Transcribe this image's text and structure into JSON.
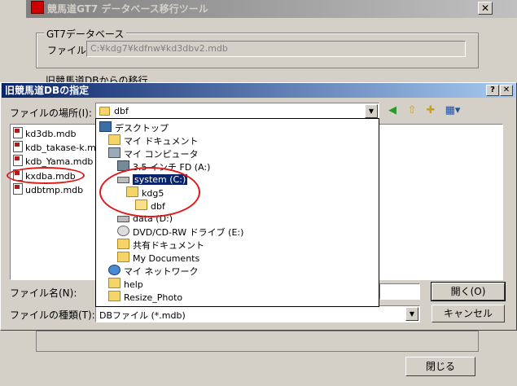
{
  "background_window": {
    "title": "競馬道GT7 データベース移行ツール",
    "close_glyph": "✕",
    "group_label": "GT7データベース",
    "file_label": "ファイル:",
    "file_value": "C:¥kdg7¥kdfnw¥kd3dbv2.mdb",
    "group2_label": "旧競馬道DBからの移行",
    "close_button": "閉じる"
  },
  "dialog": {
    "title": "旧競馬道DBの指定",
    "help_glyph": "?",
    "close_glyph": "✕",
    "look_in_label": "ファイルの場所(I):",
    "look_in_value": "dbf",
    "files": [
      "kd3db.mdb",
      "kdb_takase-k.mdb",
      "kdb_Yama.mdb",
      "kxdba.mdb",
      "udbtmp.mdb"
    ],
    "filename_label": "ファイル名(N):",
    "filetype_label": "ファイルの種類(T):",
    "filetype_value": "DBファイル (*.mdb)",
    "open_button": "開く(O)",
    "cancel_button": "キャンセル"
  },
  "dropdown": {
    "items": [
      {
        "label": "デスクトップ",
        "icon": "desktop-icon",
        "indent": 0
      },
      {
        "label": "マイ ドキュメント",
        "icon": "my-documents-icon",
        "indent": 1
      },
      {
        "label": "マイ コンピュータ",
        "icon": "my-computer-icon",
        "indent": 1
      },
      {
        "label": "3.5 インチ FD (A:)",
        "icon": "floppy-icon",
        "indent": 2
      },
      {
        "label": "system (C:)",
        "icon": "hard-drive-icon",
        "indent": 2,
        "selected": true
      },
      {
        "label": "kdg5",
        "icon": "folder-icon",
        "indent": 3
      },
      {
        "label": "dbf",
        "icon": "open-folder-icon",
        "indent": 4
      },
      {
        "label": "data (D:)",
        "icon": "hard-drive-icon",
        "indent": 2
      },
      {
        "label": "DVD/CD-RW ドライブ (E:)",
        "icon": "cd-drive-icon",
        "indent": 2
      },
      {
        "label": "共有ドキュメント",
        "icon": "shared-folder-icon",
        "indent": 2
      },
      {
        "label": "My Documents",
        "icon": "folder-icon",
        "indent": 2
      },
      {
        "label": "マイ ネットワーク",
        "icon": "network-icon",
        "indent": 1
      },
      {
        "label": "help",
        "icon": "folder-icon",
        "indent": 1
      },
      {
        "label": "Resize_Photo",
        "icon": "folder-icon",
        "indent": 1
      }
    ]
  },
  "colors": {
    "title_active": "#0a246a",
    "title_inactive": "#808080",
    "face": "#d4d0c8",
    "annotation_red": "#e01818"
  }
}
